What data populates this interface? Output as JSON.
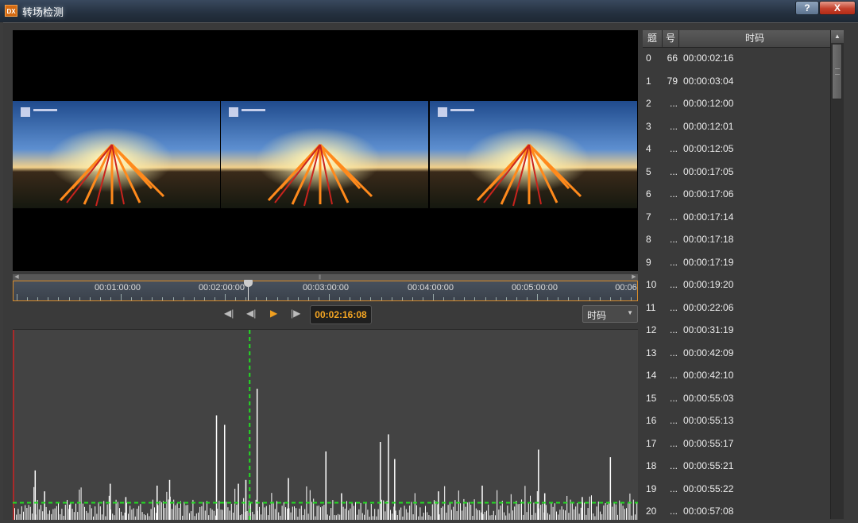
{
  "window": {
    "icon_text": "DX",
    "title": "转场检测",
    "help_label": "?",
    "close_label": "X"
  },
  "timeline": {
    "labels": [
      "00:01:00:00",
      "00:02:00:00",
      "00:03:00:00",
      "00:04:00:00",
      "00:05:00:00",
      "00:06"
    ],
    "playhead_fraction": 0.376,
    "scroll_grip": "||||"
  },
  "controls": {
    "prev_scene_icon": "◀|",
    "prev_frame_icon": "◀|",
    "play_icon": "▶",
    "next_frame_icon": "|▶",
    "timecode": "00:02:16:08",
    "mode_select": "时码",
    "dropdown_arrow": "▼"
  },
  "colors": {
    "accent_orange": "#f5a623",
    "threshold_green": "#22dd22",
    "marker_red": "#cc2222"
  },
  "list": {
    "headers": [
      "题",
      "号",
      "时码"
    ],
    "rows": [
      {
        "num": "0",
        "count": "66",
        "time": "00:00:02:16"
      },
      {
        "num": "1",
        "count": "79",
        "time": "00:00:03:04"
      },
      {
        "num": "2",
        "count": "...",
        "time": "00:00:12:00"
      },
      {
        "num": "3",
        "count": "...",
        "time": "00:00:12:01"
      },
      {
        "num": "4",
        "count": "...",
        "time": "00:00:12:05"
      },
      {
        "num": "5",
        "count": "...",
        "time": "00:00:17:05"
      },
      {
        "num": "6",
        "count": "...",
        "time": "00:00:17:06"
      },
      {
        "num": "7",
        "count": "...",
        "time": "00:00:17:14"
      },
      {
        "num": "8",
        "count": "...",
        "time": "00:00:17:18"
      },
      {
        "num": "9",
        "count": "...",
        "time": "00:00:17:19"
      },
      {
        "num": "10",
        "count": "...",
        "time": "00:00:19:20"
      },
      {
        "num": "11",
        "count": "...",
        "time": "00:00:22:06"
      },
      {
        "num": "12",
        "count": "...",
        "time": "00:00:31:19"
      },
      {
        "num": "13",
        "count": "...",
        "time": "00:00:42:09"
      },
      {
        "num": "14",
        "count": "...",
        "time": "00:00:42:10"
      },
      {
        "num": "15",
        "count": "...",
        "time": "00:00:55:03"
      },
      {
        "num": "16",
        "count": "...",
        "time": "00:00:55:13"
      },
      {
        "num": "17",
        "count": "...",
        "time": "00:00:55:17"
      },
      {
        "num": "18",
        "count": "...",
        "time": "00:00:55:21"
      },
      {
        "num": "19",
        "count": "...",
        "time": "00:00:55:22"
      },
      {
        "num": "20",
        "count": "...",
        "time": "00:00:57:08"
      }
    ]
  },
  "scrollbar": {
    "up_arrow": "▲"
  },
  "detection_graph": {
    "threshold_level": 0.09,
    "cursor_fraction": 0.379,
    "peaks": [
      {
        "pos": 0.035,
        "val": 0.26
      },
      {
        "pos": 0.05,
        "val": 0.15
      },
      {
        "pos": 0.09,
        "val": 0.08
      },
      {
        "pos": 0.155,
        "val": 0.19
      },
      {
        "pos": 0.18,
        "val": 0.12
      },
      {
        "pos": 0.23,
        "val": 0.18
      },
      {
        "pos": 0.25,
        "val": 0.21
      },
      {
        "pos": 0.325,
        "val": 0.55
      },
      {
        "pos": 0.338,
        "val": 0.5
      },
      {
        "pos": 0.36,
        "val": 0.19
      },
      {
        "pos": 0.372,
        "val": 0.21
      },
      {
        "pos": 0.39,
        "val": 0.69
      },
      {
        "pos": 0.44,
        "val": 0.22
      },
      {
        "pos": 0.5,
        "val": 0.36
      },
      {
        "pos": 0.525,
        "val": 0.14
      },
      {
        "pos": 0.587,
        "val": 0.41
      },
      {
        "pos": 0.6,
        "val": 0.45
      },
      {
        "pos": 0.61,
        "val": 0.32
      },
      {
        "pos": 0.68,
        "val": 0.15
      },
      {
        "pos": 0.75,
        "val": 0.18
      },
      {
        "pos": 0.84,
        "val": 0.37
      },
      {
        "pos": 0.85,
        "val": 0.14
      },
      {
        "pos": 0.91,
        "val": 0.12
      },
      {
        "pos": 0.955,
        "val": 0.33
      }
    ]
  }
}
